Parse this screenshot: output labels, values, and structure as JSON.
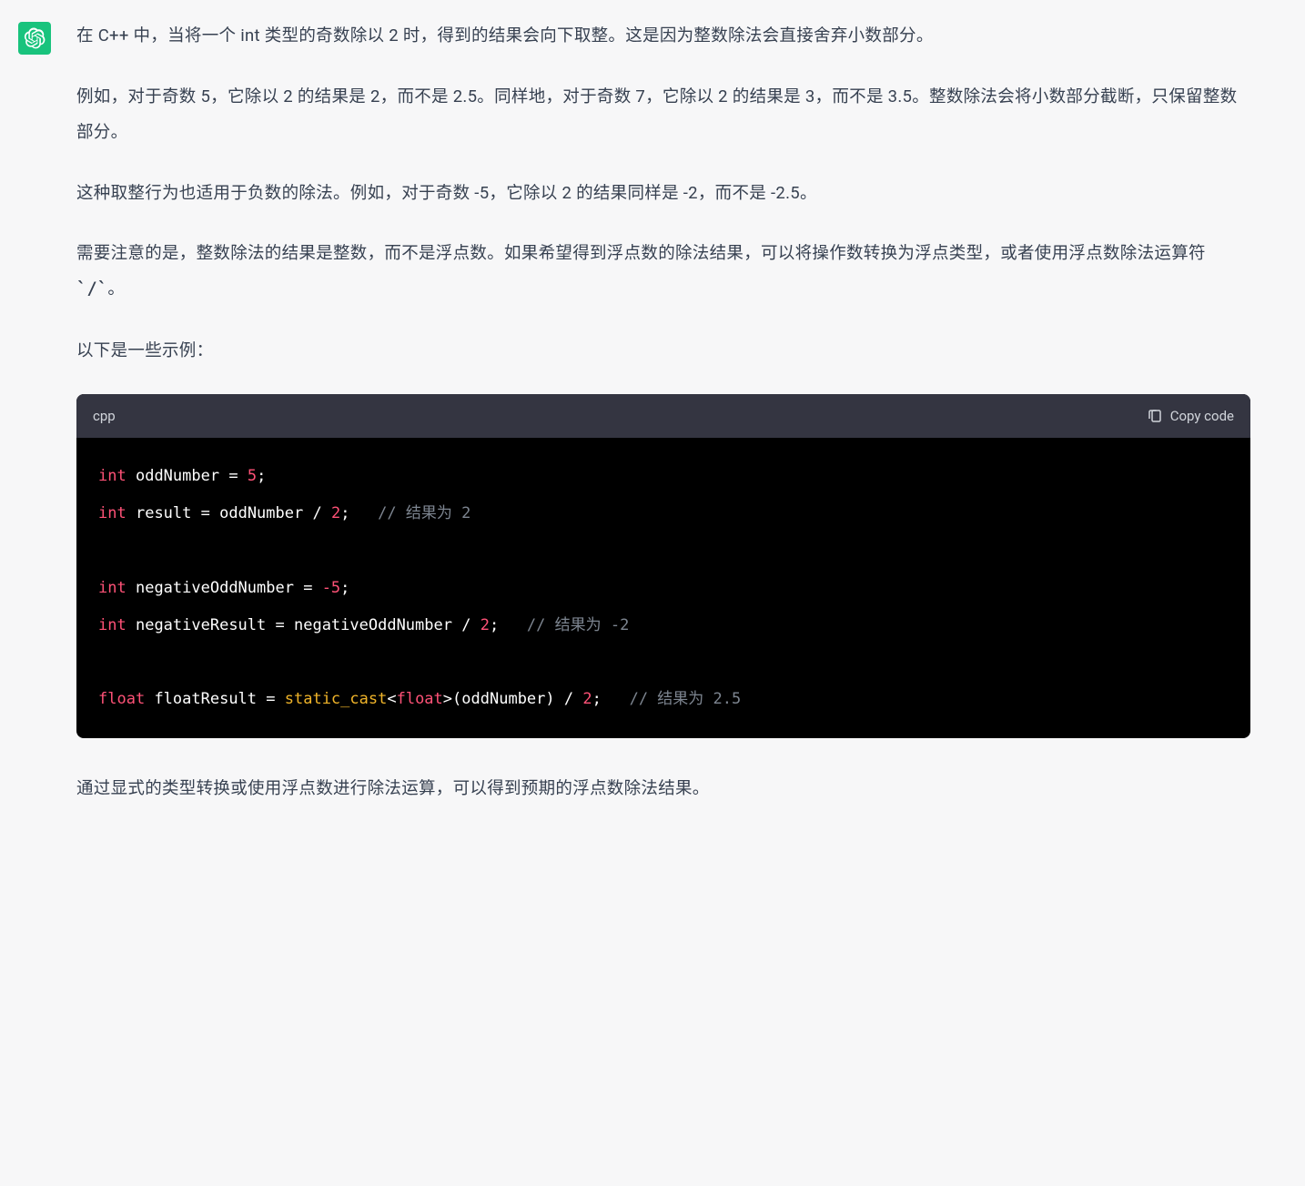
{
  "avatar": {
    "alt": "assistant-logo"
  },
  "paragraphs": {
    "p1": "在 C++ 中，当将一个 int 类型的奇数除以 2 时，得到的结果会向下取整。这是因为整数除法会直接舍弃小数部分。",
    "p2": "例如，对于奇数 5，它除以 2 的结果是 2，而不是 2.5。同样地，对于奇数 7，它除以 2 的结果是 3，而不是 3.5。整数除法会将小数部分截断，只保留整数部分。",
    "p3": "这种取整行为也适用于负数的除法。例如，对于奇数 -5，它除以 2 的结果同样是 -2，而不是 -2.5。",
    "p4_a": "需要注意的是，整数除法的结果是整数，而不是浮点数。如果希望得到浮点数的除法结果，可以将操作数转换为浮点类型，或者使用浮点数除法运算符 ",
    "p4_code": "`/`",
    "p4_b": "。",
    "p5": "以下是一些示例：",
    "p6": "通过显式的类型转换或使用浮点数进行除法运算，可以得到预期的浮点数除法结果。"
  },
  "code": {
    "language": "cpp",
    "copy_label": "Copy code",
    "tokens": {
      "kw_int": "int",
      "kw_float": "float",
      "id_oddNumber": "oddNumber",
      "id_result": "result",
      "id_negativeOddNumber": "negativeOddNumber",
      "id_negativeResult": "negativeResult",
      "id_floatResult": "floatResult",
      "fn_static_cast": "static_cast",
      "num_5": "5",
      "num_2": "2",
      "num_neg5": "-5",
      "eq": " = ",
      "slash": " / ",
      "semi": ";",
      "lt": "<",
      "gt": ">",
      "lparen": "(",
      "rparen": ")",
      "sp3": "   ",
      "sp": " ",
      "cm_r2": "// 结果为 2",
      "cm_rn2": "// 结果为 -2",
      "cm_r25": "// 结果为 2.5"
    }
  }
}
